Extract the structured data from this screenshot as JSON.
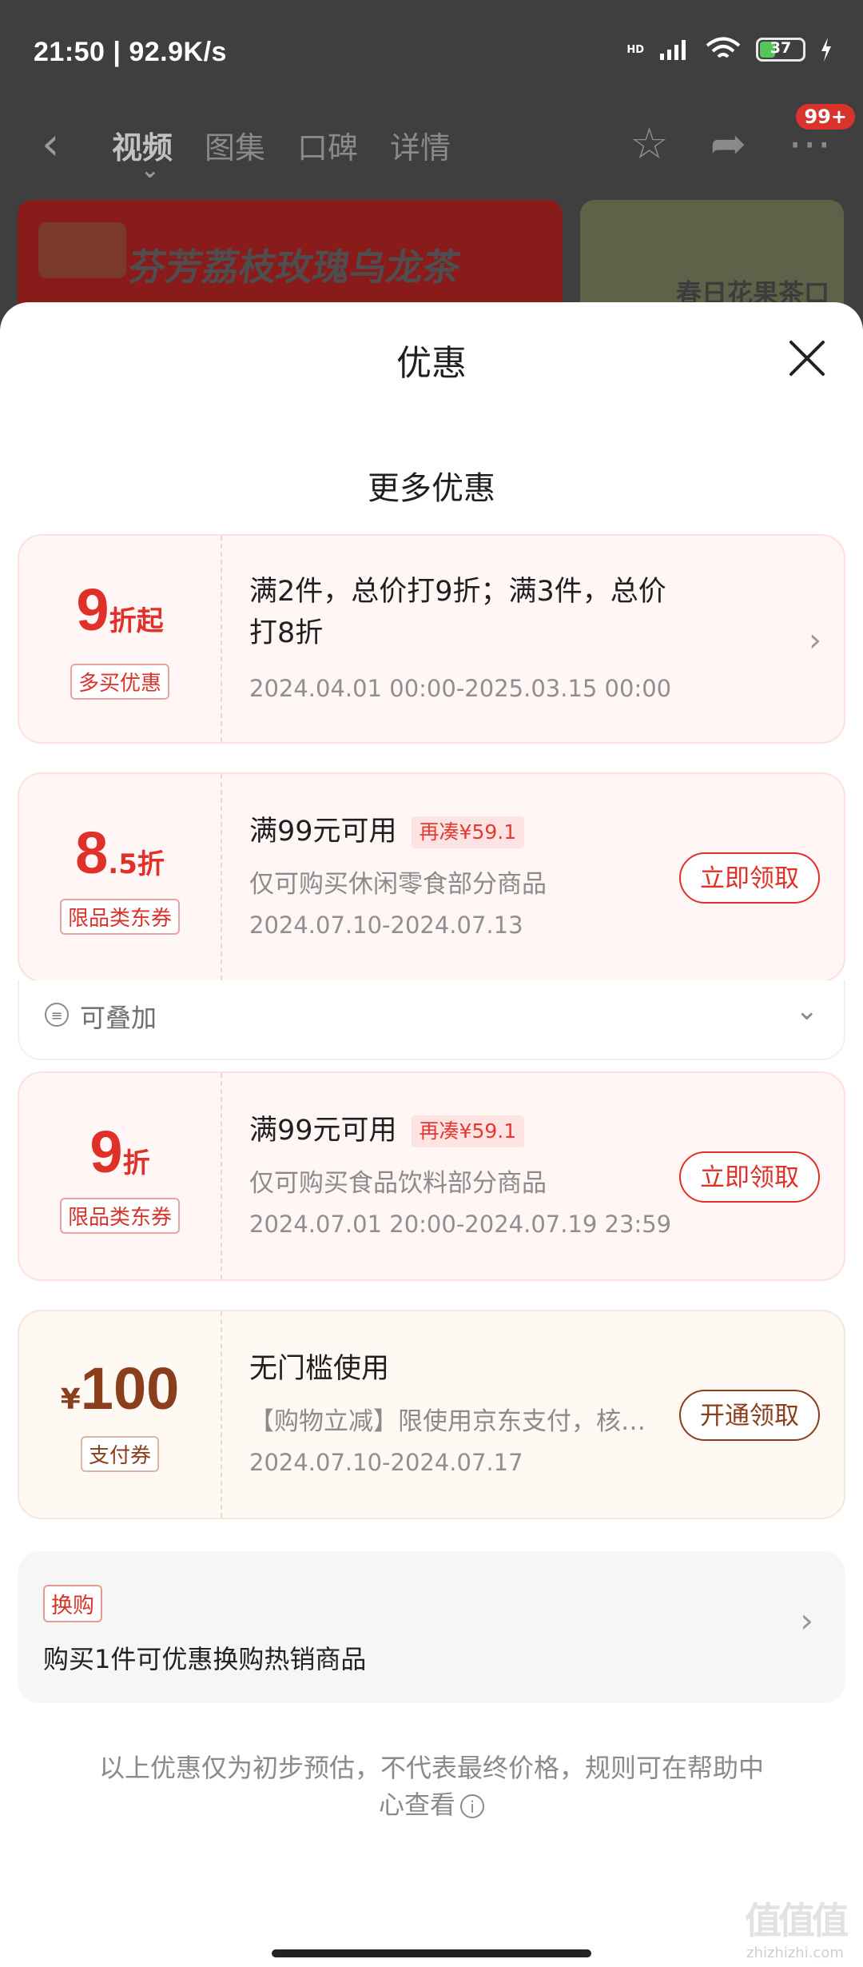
{
  "status_bar": {
    "time": "21:50 | 92.9K/s",
    "hd": "HD",
    "battery": "37"
  },
  "background_nav": {
    "back_icon": "chevron-left-icon",
    "tabs": [
      "视频",
      "图集",
      "口碑",
      "详情"
    ],
    "badge": "99+",
    "banner1_text": "芬芳荔枝玫瑰乌龙茶",
    "banner2_text": "春日花果茶口味"
  },
  "sheet": {
    "title": "优惠",
    "section_title": "更多优惠",
    "close_icon": "close-icon"
  },
  "offers": [
    {
      "value": "9",
      "unit": "折起",
      "tag": "多买优惠",
      "main_line1": "满2件，总价打9折；满3件，总价",
      "main_line2": "打8折",
      "date": "2024.04.01 00:00-2025.03.15 00:00"
    },
    {
      "value": "8",
      "unit": ".5折",
      "tag": "限品类东券",
      "main": "满99元可用",
      "pill": "再凑¥59.1",
      "sub": "仅可购买休闲零食部分商品",
      "date": "2024.07.10-2024.07.13",
      "button": "立即领取",
      "stack_label": "可叠加"
    },
    {
      "value": "9",
      "unit": "折",
      "tag": "限品类东券",
      "main": "满99元可用",
      "pill": "再凑¥59.1",
      "sub": "仅可购买食品饮料部分商品",
      "date": "2024.07.01 20:00-2024.07.19 23:59",
      "button": "立即领取"
    },
    {
      "currency": "¥",
      "value": "100",
      "tag": "支付券",
      "main": "无门槛使用",
      "sub": "【购物立减】限使用京东支付，核…",
      "date": "2024.07.10-2024.07.17",
      "button": "开通领取"
    }
  ],
  "swap": {
    "tag": "换购",
    "text": "购买1件可优惠换购热销商品"
  },
  "footer": {
    "text": "以上优惠仅为初步预估，不代表最终价格，规则可在帮助中心查看"
  },
  "watermark": {
    "main": "值值值",
    "sub": "zhizhizhi.com"
  }
}
